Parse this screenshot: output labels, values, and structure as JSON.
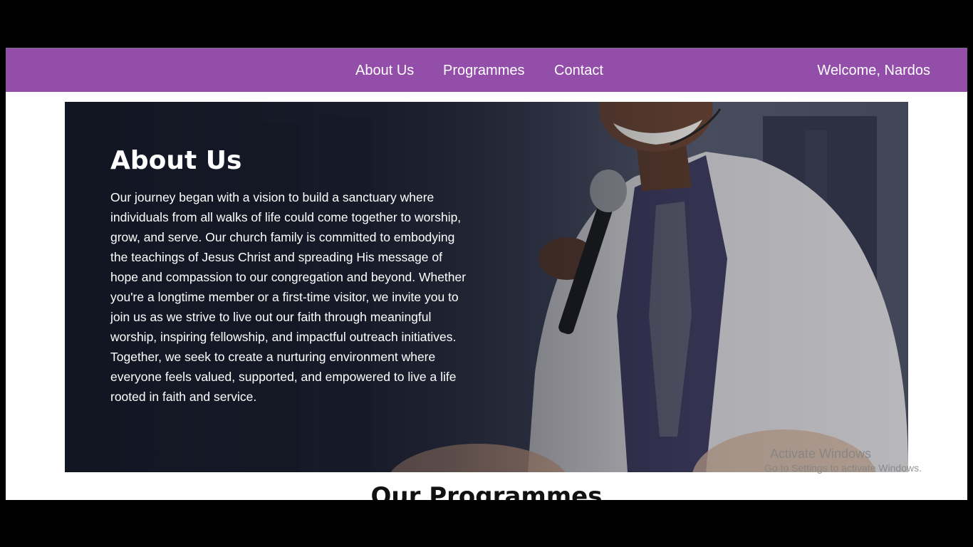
{
  "navbar": {
    "links": [
      "About Us",
      "Programmes",
      "Contact"
    ],
    "welcome": "Welcome, Nardos",
    "color": "#924ea8"
  },
  "hero": {
    "title": "About Us",
    "text": "Our journey began with a vision to build a sanctuary where individuals from all walks of life could come together to worship, grow, and serve. Our church family is committed to embodying the teachings of Jesus Christ and spreading His message of hope and compassion to our congregation and beyond. Whether you're a longtime member or a first-time visitor, we invite you to join us as we strive to live out our faith through meaningful worship, inspiring fellowship, and impactful outreach initiatives. Together, we seek to create a nurturing environment where everyone feels valued, supported, and empowered to live a life rooted in faith and service."
  },
  "programmes": {
    "title": "Our Programmes"
  },
  "watermark": {
    "title": "Activate Windows",
    "subtitle": "Go to Settings to activate Windows."
  }
}
